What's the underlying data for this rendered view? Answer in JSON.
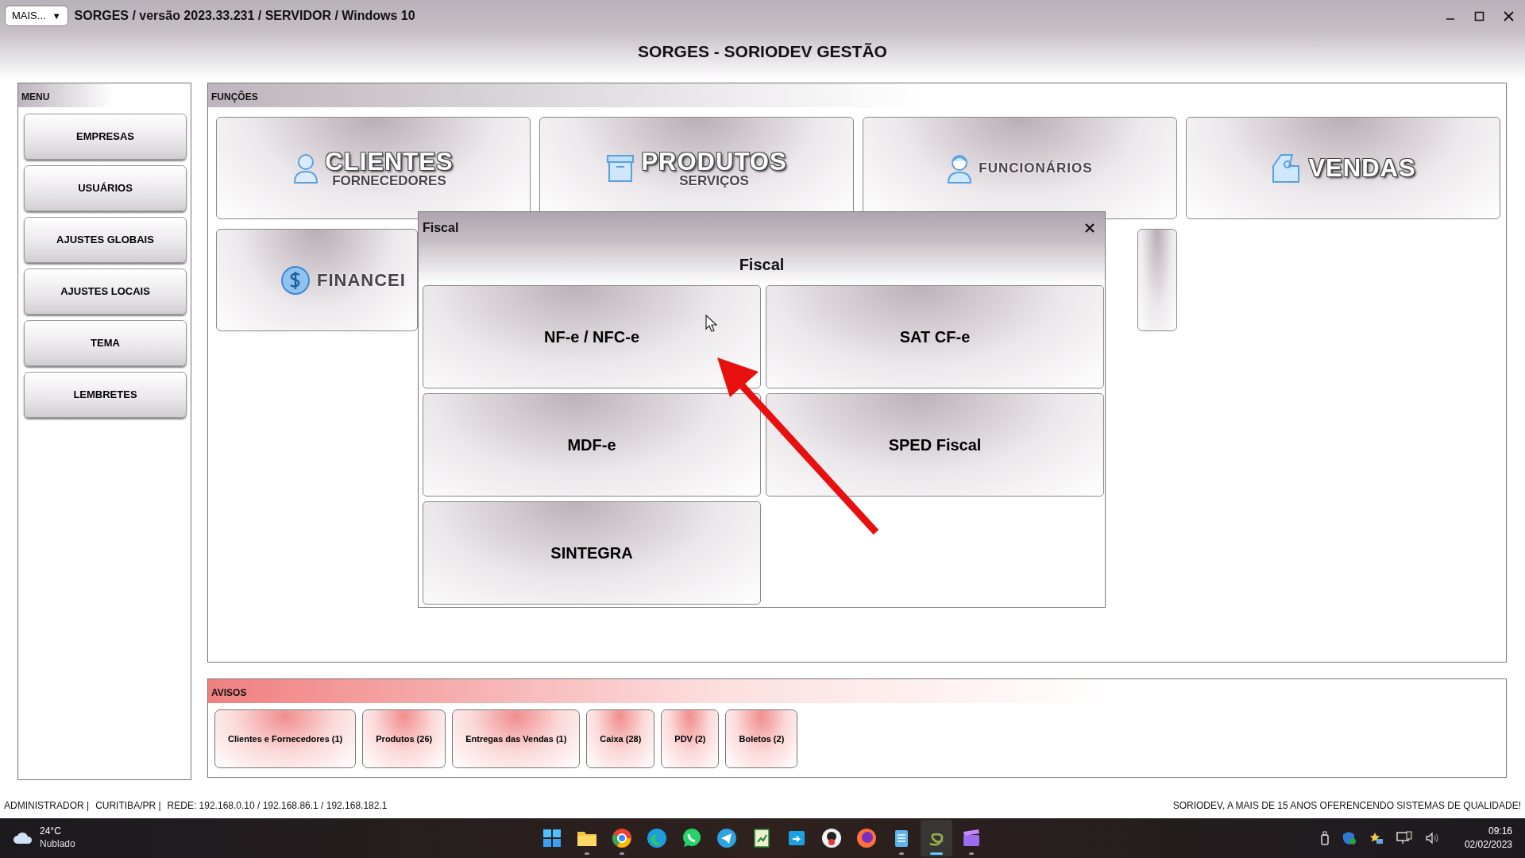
{
  "window": {
    "menu_button": "MAIS...",
    "menu_caret": "▼",
    "title": "SORGES / versão 2023.33.231 / SERVIDOR / Windows 10"
  },
  "header": "SORGES - SORIODEV GESTÃO",
  "menu": {
    "title": "MENU",
    "items": [
      "EMPRESAS",
      "USUÁRIOS",
      "AJUSTES GLOBAIS",
      "AJUSTES LOCAIS",
      "TEMA",
      "LEMBRETES"
    ]
  },
  "functions": {
    "title": "FUNÇÕES",
    "tiles": [
      {
        "title": "CLIENTES",
        "subtitle": "FORNECEDORES"
      },
      {
        "title": "PRODUTOS",
        "subtitle": "SERVIÇOS"
      },
      {
        "title": "FUNCIONÁRIOS"
      },
      {
        "title": "VENDAS"
      },
      {
        "title": "FINANCEI"
      }
    ]
  },
  "dialog": {
    "title": "Fiscal",
    "heading": "Fiscal",
    "buttons": [
      "NF-e / NFC-e",
      "SAT CF-e",
      "MDF-e",
      "SPED Fiscal",
      "SINTEGRA"
    ]
  },
  "notices": {
    "title": "AVISOS",
    "buttons": [
      "Clientes e Fornecedores (1)",
      "Produtos (26)",
      "Entregas das Vendas (1)",
      "Caixa (28)",
      "PDV (2)",
      "Boletos (2)"
    ]
  },
  "status_bar": {
    "left": [
      "ADMINISTRADOR |",
      "CURITIBA/PR |",
      "REDE: 192.168.0.10 / 192.168.86.1 / 192.168.182.1"
    ],
    "right": "SORIODEV, A MAIS DE 15 ANOS OFERENCENDO SISTEMAS DE QUALIDADE!"
  },
  "taskbar": {
    "weather": {
      "temperature": "24°C",
      "condition": "Nublado"
    },
    "apps": [
      {
        "running": false,
        "selected": false
      },
      {
        "running": true,
        "selected": false
      },
      {
        "running": true,
        "selected": false
      },
      {
        "running": false,
        "selected": false
      },
      {
        "running": false,
        "selected": false
      },
      {
        "running": false,
        "selected": false
      },
      {
        "running": false,
        "selected": false
      },
      {
        "running": false,
        "selected": false
      },
      {
        "running": false,
        "selected": false
      },
      {
        "running": false,
        "selected": false
      },
      {
        "running": true,
        "selected": false
      },
      {
        "running": true,
        "selected": true
      },
      {
        "running": true,
        "selected": false
      }
    ],
    "clock": {
      "time": "09:16",
      "date": "02/02/2023"
    }
  }
}
